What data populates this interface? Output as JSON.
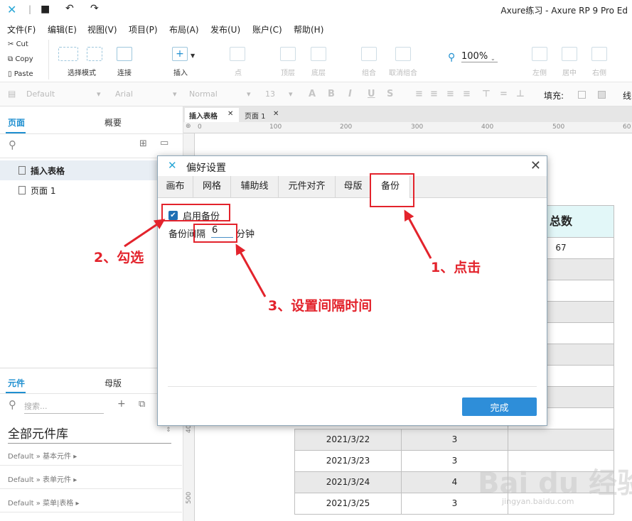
{
  "window": {
    "title": "Axure练习 - Axure RP 9 Pro Ed"
  },
  "menu": [
    "文件(F)",
    "编辑(E)",
    "视图(V)",
    "项目(P)",
    "布局(A)",
    "发布(U)",
    "账户(C)",
    "帮助(H)"
  ],
  "clipboard": {
    "cut": "Cut",
    "copy": "Copy",
    "paste": "Paste"
  },
  "toolbar": {
    "select_mode": "选择模式",
    "connect": "连接",
    "insert": "插入",
    "point": "点",
    "top": "顶层",
    "bottom": "底层",
    "group": "组合",
    "ungroup": "取消组合",
    "zoom": "100%",
    "left": "左侧",
    "center": "居中",
    "right": "右侧"
  },
  "format": {
    "style": "Default",
    "font": "Arial",
    "weight": "Normal",
    "size": "13",
    "fill_label": "填充:",
    "line_label": "线"
  },
  "pages_panel": {
    "tab_pages": "页面",
    "tab_outline": "概要",
    "pages": [
      "插入表格",
      "页面 1"
    ],
    "selected": 0
  },
  "widgets_panel": {
    "tab_widgets": "元件",
    "tab_masters": "母版",
    "search_placeholder": "搜索...",
    "library_title": "全部元件库",
    "libraries": [
      "Default » 基本元件 ▸",
      "Default » 表单元件 ▸",
      "Default » 菜单|表格 ▸"
    ]
  },
  "doc_tabs": [
    "插入表格",
    "页面 1"
  ],
  "rulers": {
    "h": [
      "0",
      "100",
      "200",
      "300",
      "400",
      "500",
      "60"
    ],
    "v": [
      "400",
      "500"
    ]
  },
  "table": {
    "header_total": "总数",
    "top_value": "67",
    "rows": [
      {
        "date": "2021/3/22",
        "count": "3"
      },
      {
        "date": "2021/3/23",
        "count": "3"
      },
      {
        "date": "2021/3/24",
        "count": "4"
      },
      {
        "date": "2021/3/25",
        "count": "3"
      }
    ]
  },
  "dialog": {
    "title": "偏好设置",
    "close": "✕",
    "tabs": [
      "画布",
      "网格",
      "辅助线",
      "元件对齐",
      "母版",
      "备份"
    ],
    "active_tab": "备份",
    "enable_backup_label": "启用备份",
    "enable_backup_checked": true,
    "interval_label": "备份间隔",
    "interval_value": "6",
    "interval_unit": "分钟",
    "done_button": "完成"
  },
  "annotations": {
    "step1": "1、点击",
    "step2": "2、勾选",
    "step3": "3、设置间隔时间",
    "color": "#e3232c"
  },
  "watermark": {
    "main": "Bai du 经验",
    "sub": "jingyan.baidu.com"
  }
}
